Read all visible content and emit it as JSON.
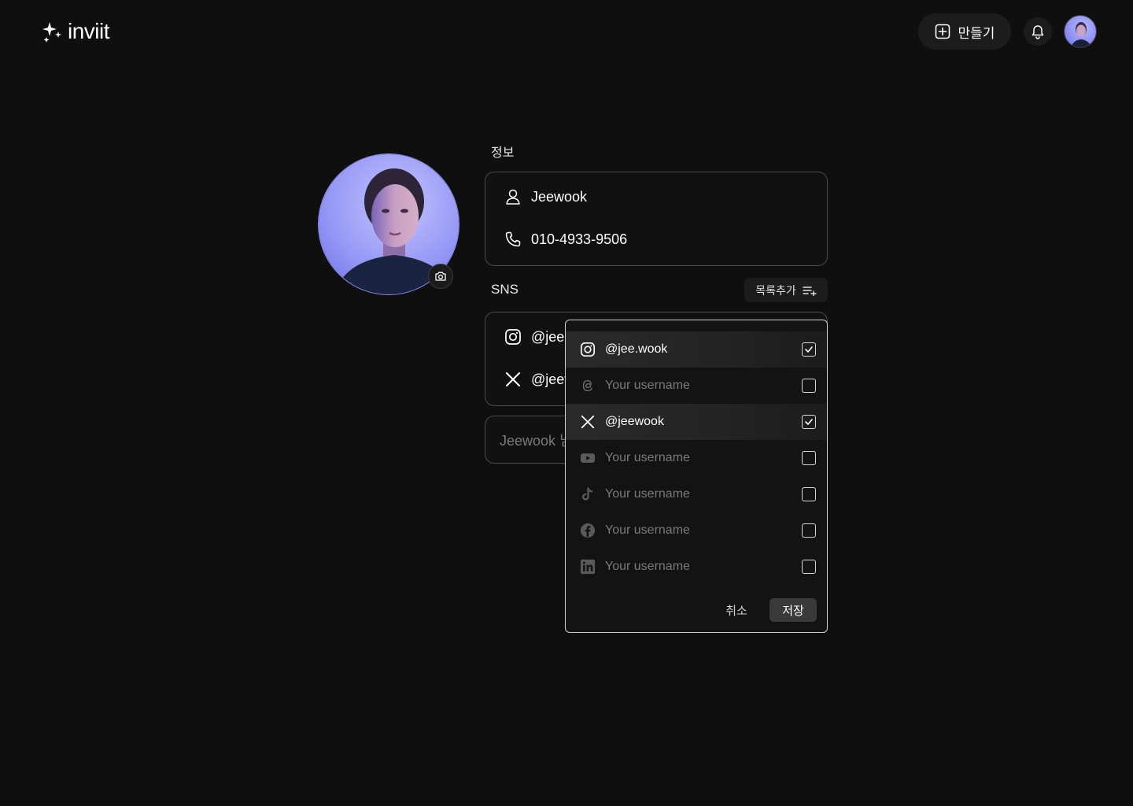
{
  "header": {
    "logo_text": "inviit",
    "create_label": "만들기"
  },
  "info": {
    "section_label": "정보",
    "name": "Jeewook",
    "phone": "010-4933-9506"
  },
  "sns": {
    "section_label": "SNS",
    "add_list_label": "목록추가",
    "visible_rows": [
      {
        "icon": "instagram-icon",
        "value": "@jee."
      },
      {
        "icon": "x-icon",
        "value": "@jeev"
      }
    ]
  },
  "message_input": {
    "value": "Jeewook 님"
  },
  "dropdown": {
    "items": [
      {
        "icon": "instagram-icon",
        "value": "@jee.wook",
        "placeholder": false,
        "checked": true,
        "selected": true
      },
      {
        "icon": "threads-icon",
        "value": "Your username",
        "placeholder": true,
        "checked": false,
        "selected": false
      },
      {
        "icon": "x-icon",
        "value": "@jeewook",
        "placeholder": false,
        "checked": true,
        "selected": true
      },
      {
        "icon": "youtube-icon",
        "value": "Your username",
        "placeholder": true,
        "checked": false,
        "selected": false
      },
      {
        "icon": "tiktok-icon",
        "value": "Your username",
        "placeholder": true,
        "checked": false,
        "selected": false
      },
      {
        "icon": "facebook-icon",
        "value": "Your username",
        "placeholder": true,
        "checked": false,
        "selected": false
      },
      {
        "icon": "linkedin-icon",
        "value": "Your username",
        "placeholder": true,
        "checked": false,
        "selected": false
      }
    ],
    "cancel_label": "취소",
    "save_label": "저장"
  },
  "colors": {
    "background": "#0f0f0f",
    "surface": "#1c1c1c",
    "border": "#4a4a4a",
    "placeholder": "#7a7a7a",
    "avatar_accent": "#8a8df0"
  }
}
